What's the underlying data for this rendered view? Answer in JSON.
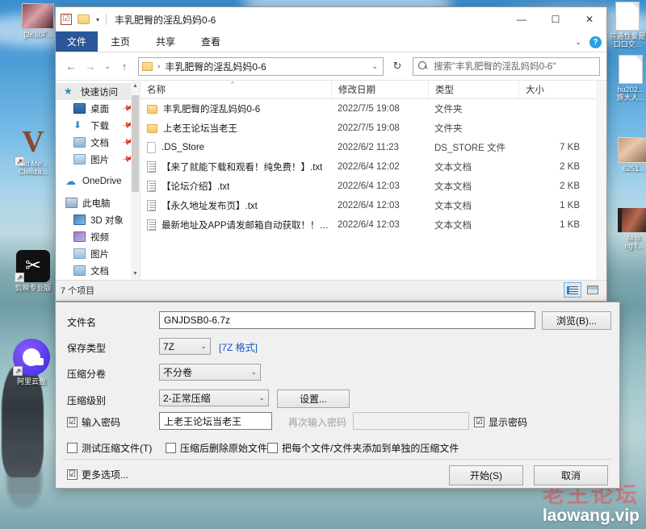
{
  "desktop": {
    "icons": [
      {
        "label": "[2K60F...",
        "kind": "thumb-pic1"
      },
      {
        "label": "Sid Me...\nCiviliza...",
        "kind": "v-logo"
      },
      {
        "label": "剪映专业版",
        "kind": "jy-logo"
      },
      {
        "label": "阿里云盘",
        "kind": "aliyun"
      },
      {
        "label": "普通性爱是\n口口交...",
        "kind": "sheet"
      },
      {
        "label": "hu202...\n族大人...",
        "kind": "sheet"
      },
      {
        "label": "6251...",
        "kind": "thumb-pic2"
      },
      {
        "label": "fa is\nng f...",
        "kind": "film"
      }
    ],
    "watermark": {
      "cn": "老王论坛",
      "en": "laowang.vip"
    }
  },
  "explorer": {
    "title": "丰乳肥臀的淫乱妈妈0-6",
    "quick_access_check": "☑",
    "window_controls": {
      "minimize": "—",
      "maximize": "☐",
      "close": "✕"
    },
    "ribbon": {
      "file_tab": "文件",
      "tabs": [
        "主页",
        "共享",
        "查看"
      ],
      "expand_caret": "⌄",
      "help": "?"
    },
    "addressbar": {
      "back": "←",
      "forward": "→",
      "recent_caret": "⌄",
      "up": "↑",
      "crumb_sep": "›",
      "path": "丰乳肥臀的淫乱妈妈0-6",
      "dropdown_caret": "⌄",
      "refresh": "↻"
    },
    "search": {
      "placeholder": "搜索\"丰乳肥臀的淫乱妈妈0-6\""
    },
    "nav_pane": {
      "items": [
        {
          "label": "快速访问",
          "icon": "star-icon",
          "pinned": false,
          "indent": 0,
          "head": true
        },
        {
          "label": "桌面",
          "icon": "desktop-icon",
          "pinned": true,
          "indent": 1
        },
        {
          "label": "下载",
          "icon": "download-icon",
          "pinned": true,
          "indent": 1
        },
        {
          "label": "文档",
          "icon": "documents-icon",
          "pinned": true,
          "indent": 1
        },
        {
          "label": "图片",
          "icon": "pictures-icon",
          "pinned": true,
          "indent": 1
        },
        {
          "label": "OneDrive",
          "icon": "cloud-icon",
          "pinned": false,
          "indent": 0
        },
        {
          "label": "此电脑",
          "icon": "this-pc-icon",
          "pinned": false,
          "indent": 0
        },
        {
          "label": "3D 对象",
          "icon": "3d-objects-icon",
          "pinned": false,
          "indent": 1
        },
        {
          "label": "视频",
          "icon": "videos-icon",
          "pinned": false,
          "indent": 1
        },
        {
          "label": "图片",
          "icon": "pictures-icon",
          "pinned": false,
          "indent": 1
        },
        {
          "label": "文档",
          "icon": "documents-icon",
          "pinned": false,
          "indent": 1
        }
      ]
    },
    "columns": [
      "名称",
      "修改日期",
      "类型",
      "大小"
    ],
    "sort_indicator": "^",
    "files": [
      {
        "name": "丰乳肥臀的淫乱妈妈0-6",
        "date": "2022/7/5 19:08",
        "type": "文件夹",
        "size": "",
        "icon": "folder"
      },
      {
        "name": "上老王论坛当老王",
        "date": "2022/7/5 19:08",
        "type": "文件夹",
        "size": "",
        "icon": "folder"
      },
      {
        "name": ".DS_Store",
        "date": "2022/6/2 11:23",
        "type": "DS_STORE 文件",
        "size": "7 KB",
        "icon": "file"
      },
      {
        "name": "【来了就能下载和观看！纯免费！】.txt",
        "date": "2022/6/4 12:02",
        "type": "文本文档",
        "size": "2 KB",
        "icon": "txt"
      },
      {
        "name": "【论坛介绍】.txt",
        "date": "2022/6/4 12:03",
        "type": "文本文档",
        "size": "2 KB",
        "icon": "txt"
      },
      {
        "name": "【永久地址发布页】.txt",
        "date": "2022/6/4 12:03",
        "type": "文本文档",
        "size": "1 KB",
        "icon": "txt"
      },
      {
        "name": "最新地址及APP请发邮箱自动获取！！！...",
        "date": "2022/6/4 12:03",
        "type": "文本文档",
        "size": "1 KB",
        "icon": "txt"
      }
    ],
    "status": "7 个项目",
    "view_buttons": {
      "details": "details-view-icon",
      "tiles": "tiles-view-icon"
    }
  },
  "zip_dialog": {
    "fields": {
      "filename_label": "文件名",
      "filename_value": "GNJDSB0-6.7z",
      "browse_button": "浏览(B)...",
      "archive_format_label": "保存类型",
      "archive_format_value": "7Z",
      "format_link": "[7Z 格式]",
      "split_label": "压缩分卷",
      "split_value": "不分卷",
      "level_label": "压缩级别",
      "level_value": "2-正常压缩",
      "settings_button": "设置...",
      "password_label": "输入密码",
      "password_value": "上老王论坛当老王",
      "password_checked": "☑",
      "repassword_label": "再次输入密码",
      "repassword_value": "",
      "show_password_label": "显示密码",
      "show_password_checked": "☑"
    },
    "checkboxes": [
      {
        "label": "测试压缩文件(T)",
        "checked": false
      },
      {
        "label": "压缩后删除原始文件",
        "checked": false
      },
      {
        "label": "把每个文件/文件夹添加到单独的压缩文件",
        "checked": false
      }
    ],
    "more_options": {
      "label": "更多选项...",
      "checked": true,
      "mark": "☑"
    },
    "buttons": {
      "start": "开始(S)",
      "cancel": "取消"
    },
    "combo_caret": "⌄"
  }
}
